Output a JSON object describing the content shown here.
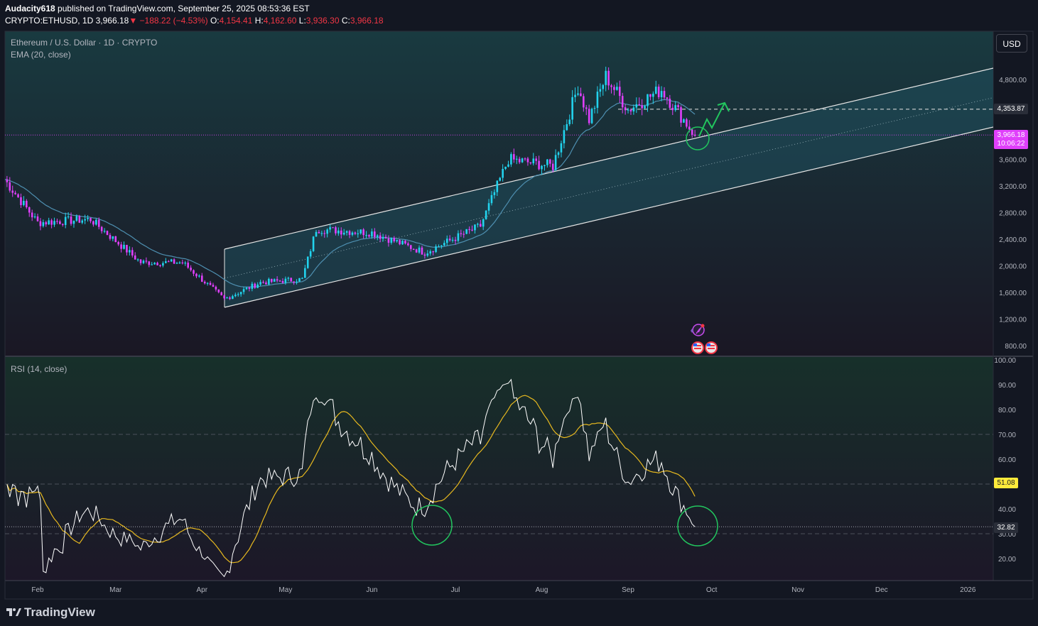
{
  "header": {
    "author": "Audacity618",
    "published": "published on TradingView.com, September 25, 2025 08:53:36 EST",
    "symbol": "CRYPTO:ETHUSD, 1D",
    "last": "3,966.18",
    "change": "−188.22 (−4.53%)",
    "open_label": "O:",
    "open": "4,154.41",
    "high_label": "H:",
    "high": "4,162.60",
    "low_label": "L:",
    "low": "3,936.30",
    "close_label": "C:",
    "close": "3,966.18"
  },
  "legend": {
    "instrument": "Ethereum / U.S. Dollar · 1D · CRYPTO",
    "ema": "EMA (20, close)",
    "rsi": "RSI (14, close)"
  },
  "currency_button": "USD",
  "brand": "TradingView",
  "colors": {
    "background": "#131722",
    "up": "#22d3ee",
    "down": "#e040fb",
    "ema": "#4e8fb0",
    "channel_fill": "#1f4f5c",
    "rsi_line": "#ffffff",
    "rsi_ma": "#e6b81f",
    "marker_circle": "#22c55e",
    "projection_arrow": "#22c55e",
    "price_label": "#e040fb",
    "rsi_value_label": "#ffeb3b"
  },
  "icons": [
    "spark-icon",
    "us-flag-icon"
  ],
  "chart_data": [
    {
      "type": "candlestick",
      "title": "Ethereum / U.S. Dollar · 1D · CRYPTO",
      "overlay": "EMA (20, close)",
      "x_ticks": [
        "Feb",
        "Mar",
        "Apr",
        "May",
        "Jun",
        "Jul",
        "Aug",
        "Sep",
        "Oct",
        "Nov",
        "Dec",
        "2026"
      ],
      "y_ticks": [
        "800.00",
        "1,200.00",
        "1,600.00",
        "2,000.00",
        "2,400.00",
        "2,800.00",
        "3,200.00",
        "3,600.00",
        "4,000.00",
        "4,400.00",
        "4,800.00"
      ],
      "ylim": [
        700,
        5000
      ],
      "current_price": "3,966.18",
      "countdown": "10:06:22",
      "level_line": "4,353.87",
      "approx_close_path": [
        [
          "2025-01-20",
          3300
        ],
        [
          "2025-02-01",
          2650
        ],
        [
          "2025-02-20",
          2700
        ],
        [
          "2025-03-10",
          2050
        ],
        [
          "2025-03-25",
          2050
        ],
        [
          "2025-04-09",
          1500
        ],
        [
          "2025-04-22",
          1750
        ],
        [
          "2025-05-07",
          1800
        ],
        [
          "2025-05-12",
          2550
        ],
        [
          "2025-06-01",
          2500
        ],
        [
          "2025-06-20",
          2200
        ],
        [
          "2025-07-10",
          2600
        ],
        [
          "2025-07-20",
          3600
        ],
        [
          "2025-08-05",
          3500
        ],
        [
          "2025-08-14",
          4700
        ],
        [
          "2025-08-18",
          4200
        ],
        [
          "2025-08-24",
          4850
        ],
        [
          "2025-09-01",
          4350
        ],
        [
          "2025-09-13",
          4650
        ],
        [
          "2025-09-25",
          3966
        ]
      ],
      "channel": "ascending parallel channel from April 2025 into 2026",
      "annotations": [
        "green circle at channel support",
        "green projection arrow to 4,353.87"
      ]
    },
    {
      "type": "line",
      "title": "RSI (14, close)",
      "y_ticks": [
        "20.00",
        "30.00",
        "40.00",
        "50.00",
        "60.00",
        "70.00",
        "80.00",
        "90.00",
        "100.00"
      ],
      "ylim": [
        10,
        100
      ],
      "current_value": "32.82",
      "ma_value": "51.08",
      "bands": [
        30,
        50,
        70
      ],
      "annotations": [
        "green circle at June low ~33",
        "green circle at September low ~33"
      ]
    }
  ]
}
